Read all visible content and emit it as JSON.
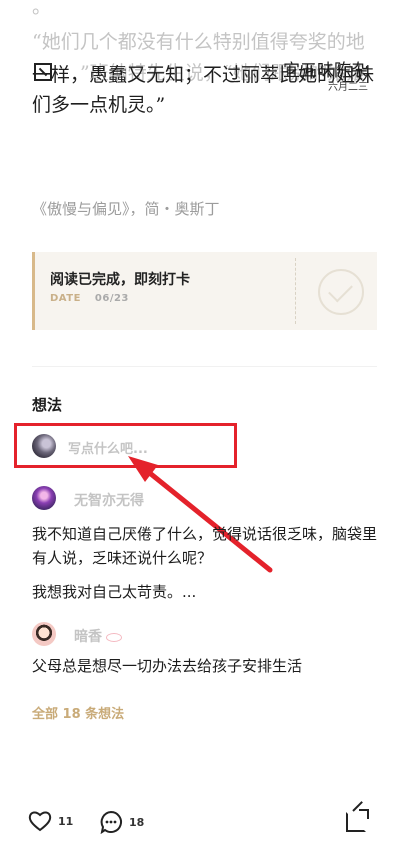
{
  "article": {
    "quote_lines_faded": [
      "。",
      "“她们几个都没有什么特别值得夸奖的地",
      "”班纳特先生说，“她们跟别的姑娘"
    ],
    "quote_line_overlap": "一样，愚蠢又无知；不过丽萃比她的姐妹",
    "quote_line_last": "们多一点机灵。”",
    "source": "《傲慢与偏见》，简・奥斯丁"
  },
  "header": {
    "title": "宜五味陈杂",
    "date": "六月二三"
  },
  "checkin": {
    "title": "阅读已完成，即刻打卡",
    "date_label": "DATE",
    "date_value": "06/23"
  },
  "thoughts": {
    "section_title": "想法",
    "input_placeholder": "写点什么吧...",
    "comments": [
      {
        "author": "无智亦无得",
        "text": "我不知道自己厌倦了什么，觉得说话很乏味，脑袋里有人说，乏味还说什么呢？",
        "text2": "我想我对自己太苛责。..."
      },
      {
        "author": "暗香",
        "text": "父母总是想尽一切办法去给孩子安排生活"
      }
    ],
    "all_label": "全部 18 条想法"
  },
  "bottom_bar": {
    "like_count": "11",
    "comment_count": "18"
  },
  "colors": {
    "highlight": "#e4222b",
    "accent_gold": "#c9ab79"
  }
}
